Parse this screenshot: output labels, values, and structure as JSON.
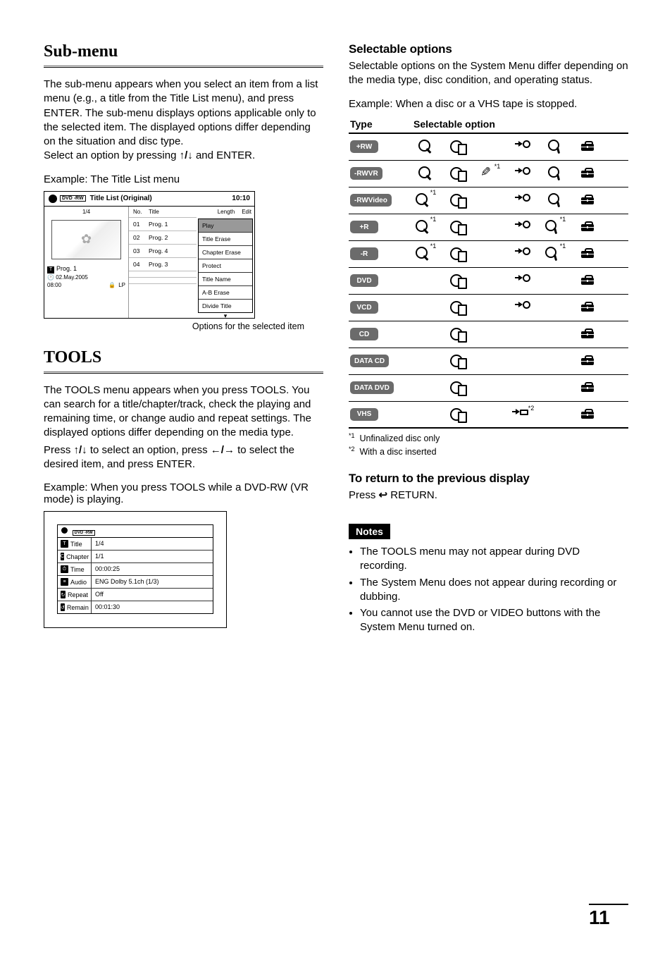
{
  "page_number": "11",
  "left": {
    "submenu": {
      "title": "Sub-menu",
      "p1a": "The sub-menu appears when you select an item from a list menu (e.g., a title from the Title List menu), and press ENTER. The sub-menu displays options applicable only to the selected item. The displayed options differ depending on the situation and disc type.",
      "p1b_pre": "Select an option by pressing ",
      "p1b_mid": " and ENTER.",
      "example_caption": "Example: The Title List menu",
      "osd": {
        "disc_badge": "DVD -RW",
        "header": "Title List (Original)",
        "clock": "10:10",
        "page": "1/4",
        "col_no": "No.",
        "col_title": "Title",
        "col_length": "Length",
        "col_edit": "Edit",
        "rows": [
          {
            "no": "01",
            "title": "Prog. 1"
          },
          {
            "no": "02",
            "title": "Prog. 2"
          },
          {
            "no": "03",
            "title": "Prog. 4"
          },
          {
            "no": "04",
            "title": "Prog. 3"
          }
        ],
        "prog_title": "Prog. 1",
        "prog_date": "02.May.2005",
        "prog_len": "08:00",
        "prog_mode": "LP",
        "submenu_items": [
          "Play",
          "Title Erase",
          "Chapter Erase",
          "Protect",
          "Title Name",
          "A-B Erase",
          "Divide Title"
        ]
      },
      "figure_caption": "Options for the selected item"
    },
    "tools": {
      "title": "TOOLS",
      "p1": "The TOOLS menu appears when you press TOOLS. You can search for a title/chapter/track, check the playing and remaining time, or change audio and repeat settings. The displayed options differ depending on the media type.",
      "p2_pre": "Press ",
      "p2_mid": " to select an option, press ",
      "p2_post": " to select the desired item, and press ENTER.",
      "example_caption": "Example: When you press TOOLS while a DVD-RW (VR mode) is playing.",
      "osd": {
        "disc_badge": "DVD -RW",
        "rows": [
          {
            "icon": "T",
            "label": "Title",
            "val": "1/4"
          },
          {
            "icon": "C",
            "label": "Chapter",
            "val": "1/1"
          },
          {
            "icon": "⏱",
            "label": "Time",
            "val": "00:00:25"
          },
          {
            "icon": "≡",
            "label": "Audio",
            "val": "ENG Dolby 5.1ch (1/3)"
          },
          {
            "icon": "↻",
            "label": "Repeat",
            "val": "Off"
          },
          {
            "icon": "↺",
            "label": "Remain",
            "val": "00:01:30"
          }
        ]
      }
    }
  },
  "right": {
    "selectable": {
      "heading": "Selectable options",
      "intro": "Selectable options on the System Menu differ depending on the media type, disc condition, and operating status.",
      "example": "Example: When a disc or a VHS tape is stopped.",
      "th_type": "Type",
      "th_opt": "Selectable option",
      "types": [
        {
          "label": "+RW",
          "c1": true,
          "c2": true,
          "c3": false,
          "c4": true,
          "c5": true,
          "c6": true
        },
        {
          "label": "-RWVR",
          "c1": true,
          "c2": true,
          "c3": true,
          "c3sup": "*1",
          "c4": true,
          "c5": true,
          "c6": true
        },
        {
          "label": "-RWVideo",
          "c1": true,
          "c1sup": "*1",
          "c2": true,
          "c3": false,
          "c4": true,
          "c5": true,
          "c6": true
        },
        {
          "label": "+R",
          "c1": true,
          "c1sup": "*1",
          "c2": true,
          "c3": false,
          "c4": true,
          "c5": true,
          "c5sup": "*1",
          "c6": true
        },
        {
          "label": "-R",
          "c1": true,
          "c1sup": "*1",
          "c2": true,
          "c3": false,
          "c4": true,
          "c5": true,
          "c5sup": "*1",
          "c6": true
        },
        {
          "label": "DVD",
          "c1": false,
          "c2": true,
          "c3": false,
          "c4": true,
          "c5": false,
          "c6": true
        },
        {
          "label": "VCD",
          "c1": false,
          "c2": true,
          "c3": false,
          "c4": true,
          "c5": false,
          "c6": true
        },
        {
          "label": "CD",
          "c1": false,
          "c2": true,
          "c3": false,
          "c4": false,
          "c5": false,
          "c6": true
        },
        {
          "label": "DATA CD",
          "c1": false,
          "c2": true,
          "c3": false,
          "c4": false,
          "c5": false,
          "c6": true
        },
        {
          "label": "DATA DVD",
          "c1": false,
          "c2": true,
          "c3": false,
          "c4": false,
          "c5": false,
          "c6": true
        },
        {
          "label": "VHS",
          "c1": false,
          "c2": true,
          "c3": false,
          "c4": true,
          "c4sup": "*2",
          "c4alt": "tape",
          "c5": false,
          "c6": true
        }
      ],
      "footnote1_mark": "*1",
      "footnote1": "Unfinalized disc only",
      "footnote2_mark": "*2",
      "footnote2": "With a disc inserted"
    },
    "return": {
      "heading": "To return to the previous display",
      "text_pre": "Press ",
      "text_post": " RETURN."
    },
    "notes": {
      "badge": "Notes",
      "items": [
        "The TOOLS menu may not appear during DVD recording.",
        "The System Menu does not appear during recording or dubbing.",
        "You cannot use the DVD or VIDEO buttons with the System Menu turned on."
      ]
    }
  }
}
